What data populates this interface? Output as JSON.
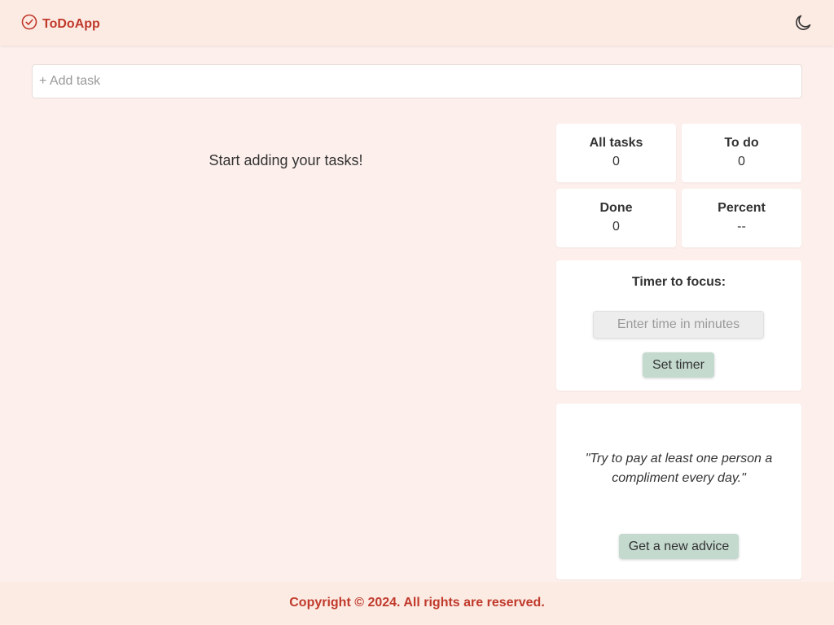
{
  "app": {
    "name": "ToDoApp",
    "logo_icon": "check-circle-icon",
    "theme_icon": "moon-icon",
    "accent": "#c0392b"
  },
  "add_task": {
    "placeholder": "+ Add task",
    "value": ""
  },
  "tasks": {
    "empty_message": "Start adding your tasks!"
  },
  "stats": {
    "all": {
      "label": "All tasks",
      "value": "0"
    },
    "todo": {
      "label": "To do",
      "value": "0"
    },
    "done": {
      "label": "Done",
      "value": "0"
    },
    "percent": {
      "label": "Percent",
      "value": "--"
    }
  },
  "timer": {
    "title": "Timer to focus:",
    "placeholder": "Enter time in minutes",
    "button": "Set timer"
  },
  "advice": {
    "quote": "\"Try to pay at least one person a compliment every day.\"",
    "button": "Get a new advice"
  },
  "footer": {
    "text": "Copyright © 2024. All rights are reserved."
  }
}
